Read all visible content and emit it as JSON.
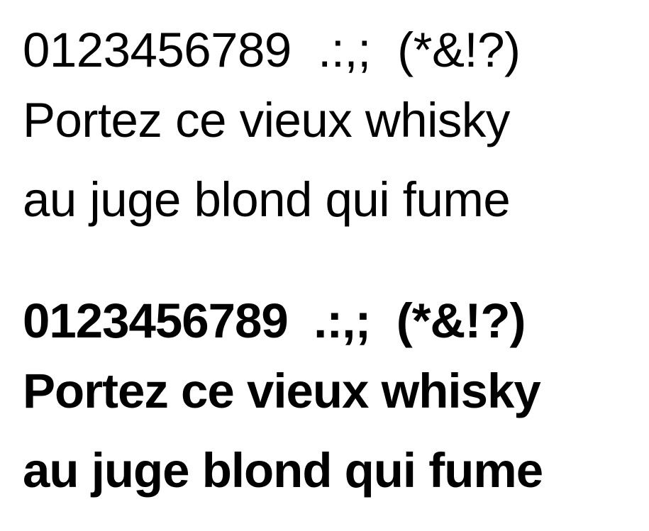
{
  "specimen": {
    "regular": {
      "line1": "0123456789  .:,;  (*&!?)",
      "line2": "Portez ce vieux whisky",
      "line3": "au juge blond qui fume"
    },
    "bold": {
      "line1": "0123456789  .:,;  (*&!?)",
      "line2": "Portez ce vieux whisky",
      "line3": "au juge blond qui fume"
    },
    "colors": {
      "text": "#000000",
      "background": "#ffffff"
    }
  }
}
